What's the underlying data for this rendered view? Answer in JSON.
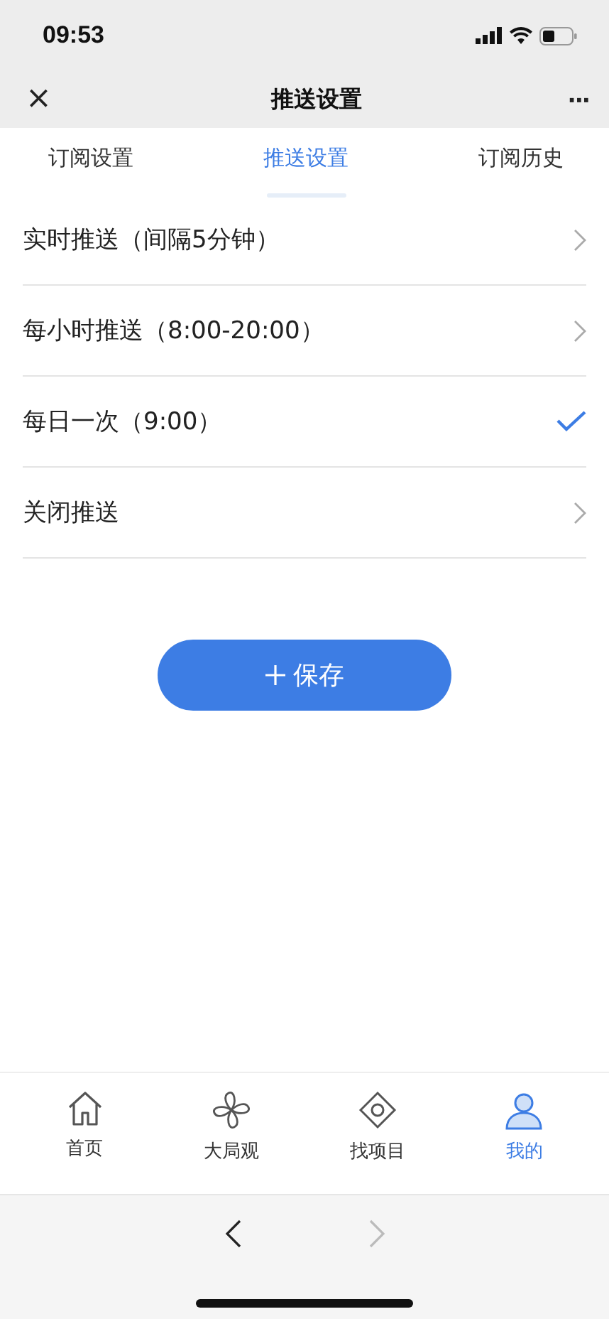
{
  "status_bar": {
    "time": "09:53"
  },
  "header": {
    "close": "×",
    "title": "推送设置",
    "more": "···"
  },
  "tabs": [
    {
      "label": "订阅设置",
      "selected": false
    },
    {
      "label": "推送设置",
      "selected": true
    },
    {
      "label": "订阅历史",
      "selected": false
    }
  ],
  "options": [
    {
      "label": "实时推送（间隔5分钟）",
      "selected": false
    },
    {
      "label": "每小时推送（8:00-20:00）",
      "selected": false
    },
    {
      "label": "每日一次（9:00）",
      "selected": true
    },
    {
      "label": "关闭推送",
      "selected": false
    }
  ],
  "save_button": {
    "label": "保存"
  },
  "bottom_nav": [
    {
      "label": "首页",
      "selected": false
    },
    {
      "label": "大局观",
      "selected": false
    },
    {
      "label": "找项目",
      "selected": false
    },
    {
      "label": "我的",
      "selected": true
    }
  ],
  "browser_bar": {
    "back": {
      "disabled": false
    },
    "forward": {
      "disabled": true
    }
  }
}
